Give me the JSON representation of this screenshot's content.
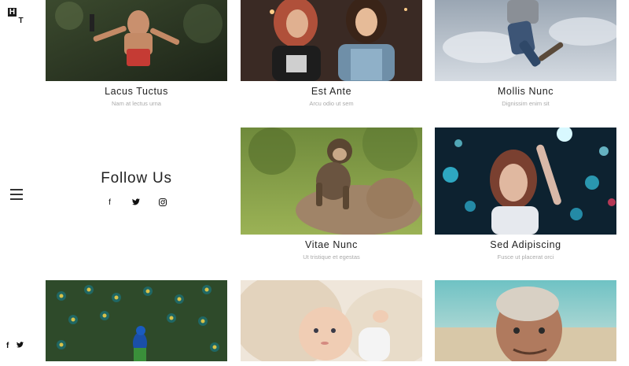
{
  "logo": {
    "letters": [
      "H",
      "T"
    ]
  },
  "side_social": {
    "facebook": "f",
    "twitter": "🐦"
  },
  "follow": {
    "title": "Follow Us",
    "facebook": "f",
    "twitter": "🐦",
    "instagram": "◎"
  },
  "cards": [
    {
      "title": "Lacus Tuctus",
      "subtitle": "Nam at lectus urna"
    },
    {
      "title": "Est Ante",
      "subtitle": "Arcu odio ut sem"
    },
    {
      "title": "Mollis Nunc",
      "subtitle": "Dignissim enim sit"
    },
    {
      "title": "Vitae Nunc",
      "subtitle": "Ut tristique et egestas"
    },
    {
      "title": "Sed Adipiscing",
      "subtitle": "Fusce ut placerat orci"
    },
    {
      "title": "",
      "subtitle": ""
    },
    {
      "title": "",
      "subtitle": ""
    },
    {
      "title": "",
      "subtitle": ""
    }
  ]
}
